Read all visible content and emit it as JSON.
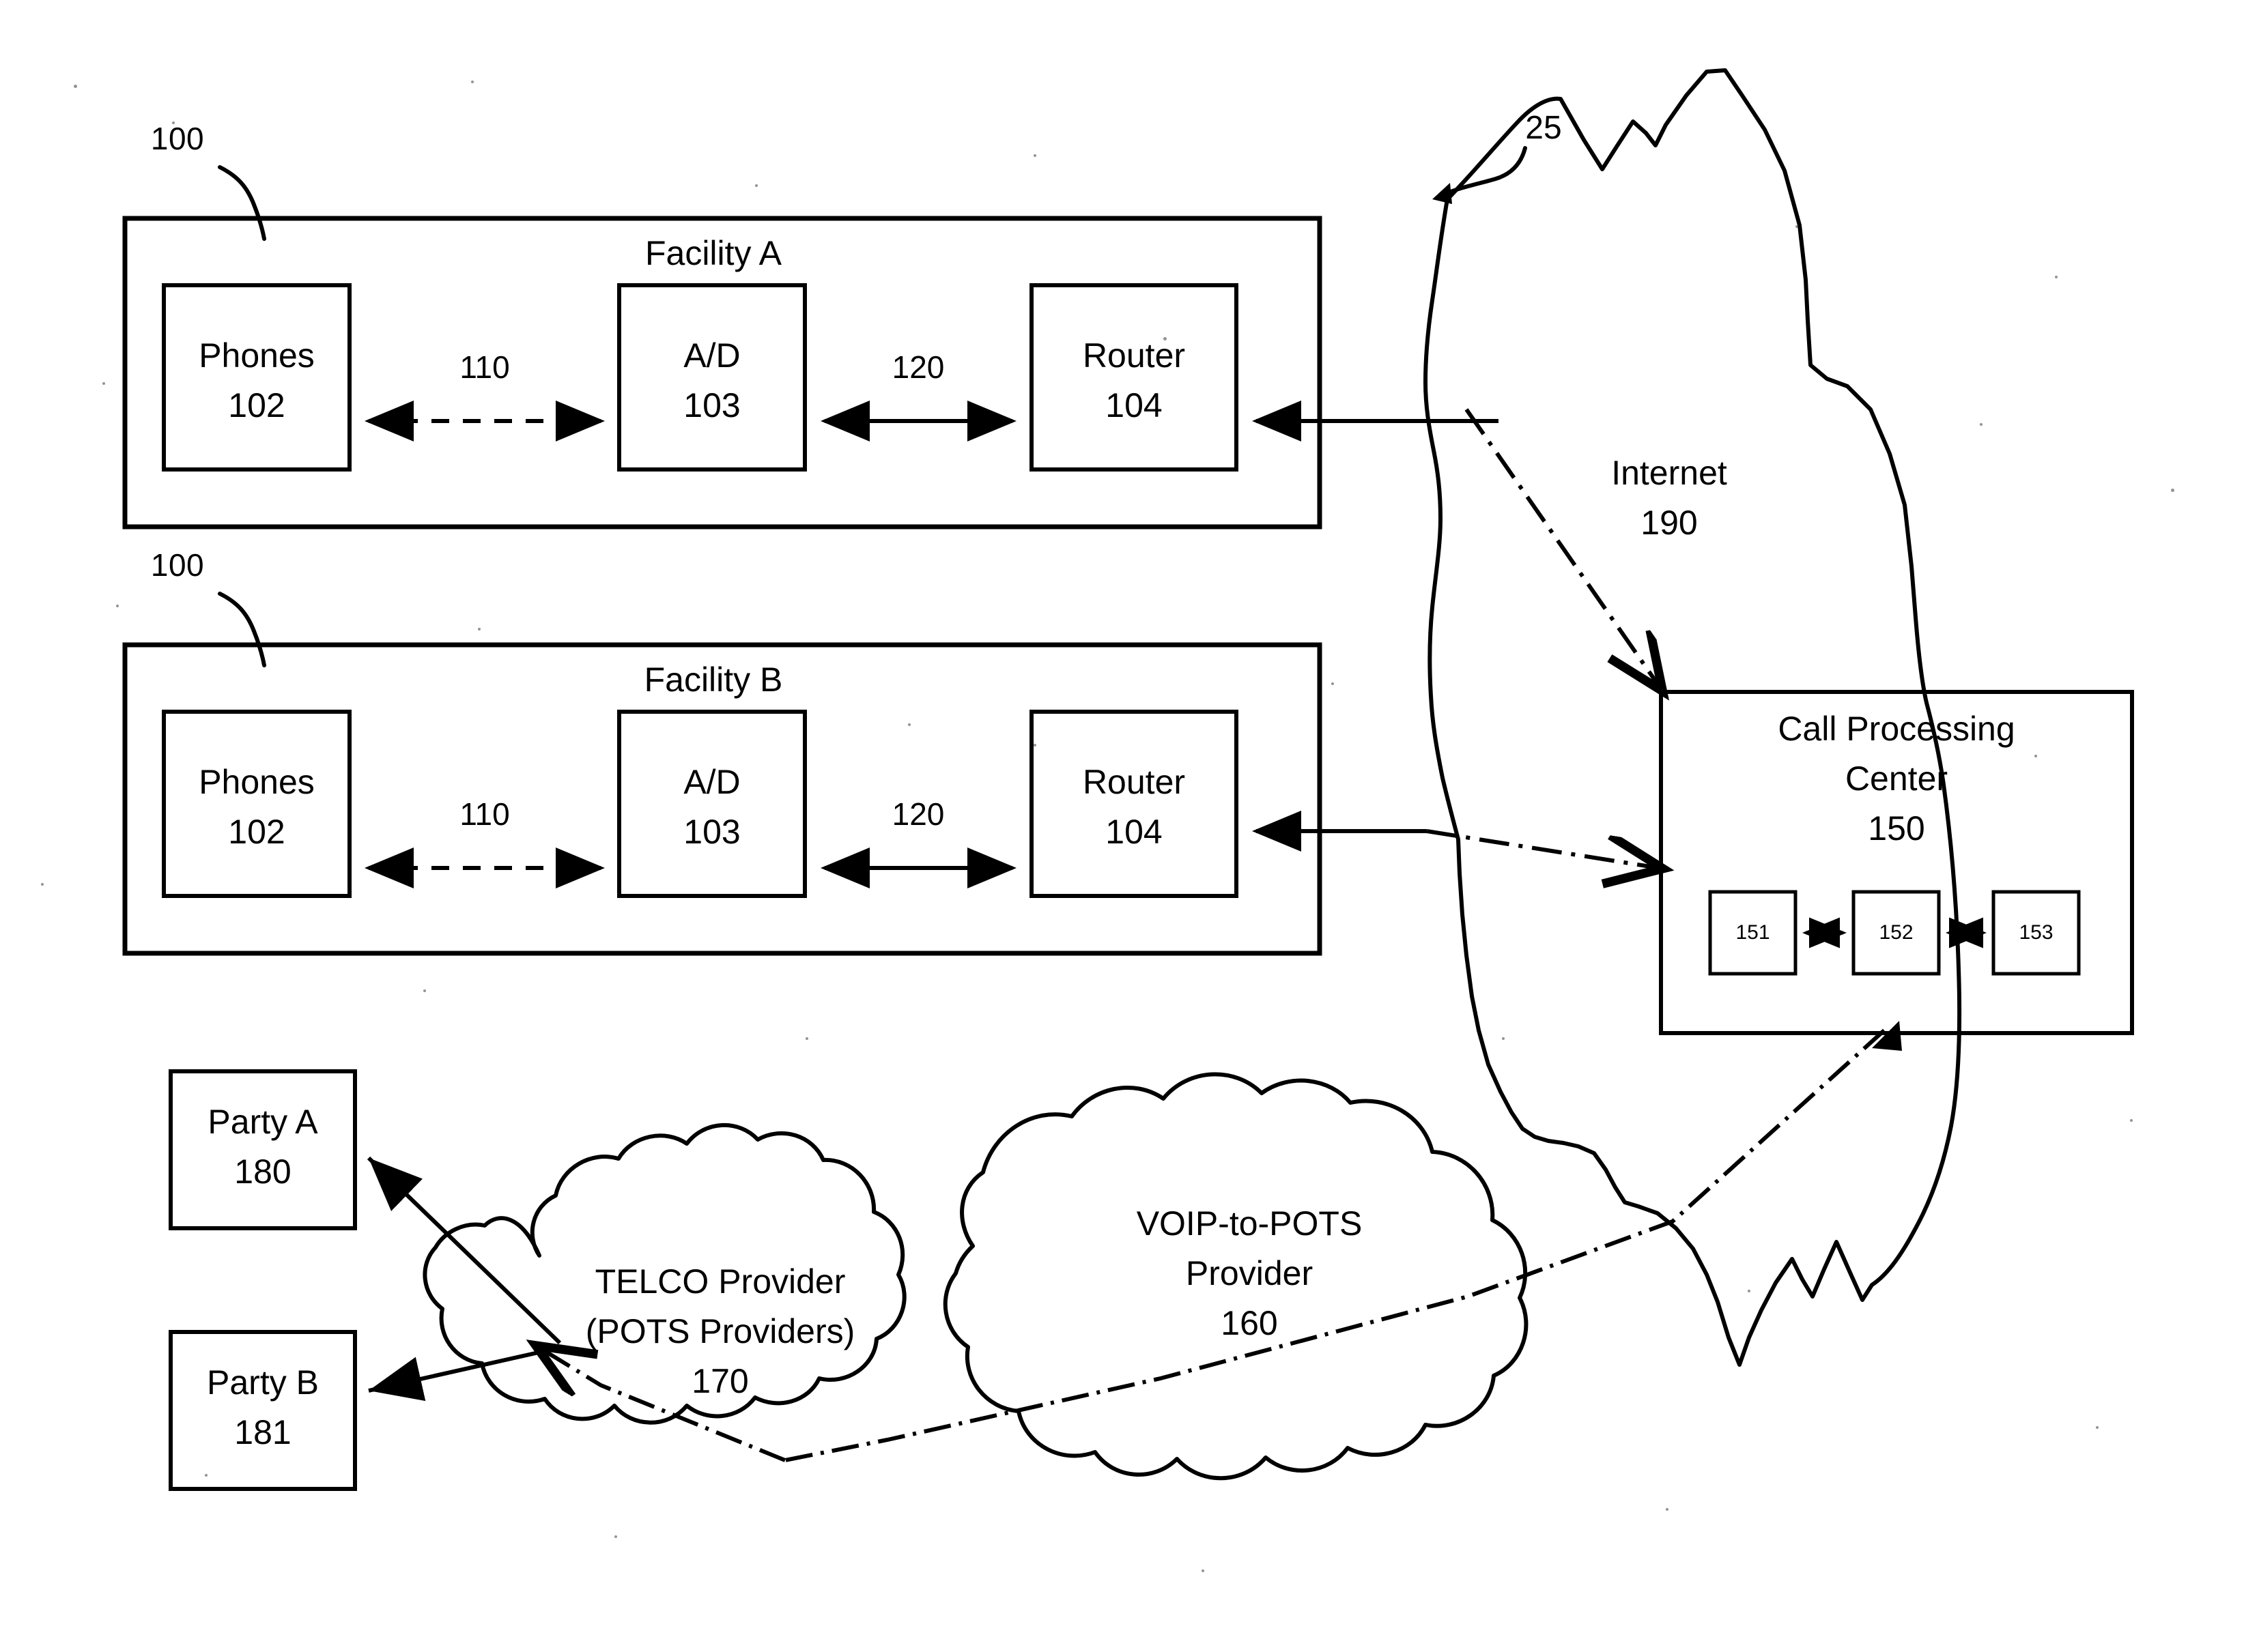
{
  "figure": {
    "figure_ref": "25"
  },
  "facilities": [
    {
      "outer_ref": "100",
      "title": "Facility A",
      "nodes": [
        {
          "name": "Phones",
          "ref": "102"
        },
        {
          "name": "A/D",
          "ref": "103"
        },
        {
          "name": "Router",
          "ref": "104"
        }
      ],
      "links": [
        {
          "ref": "110",
          "style": "dashed"
        },
        {
          "ref": "120",
          "style": "solid"
        }
      ]
    },
    {
      "outer_ref": "100",
      "title": "Facility B",
      "nodes": [
        {
          "name": "Phones",
          "ref": "102"
        },
        {
          "name": "A/D",
          "ref": "103"
        },
        {
          "name": "Router",
          "ref": "104"
        }
      ],
      "links": [
        {
          "ref": "110",
          "style": "dashed"
        },
        {
          "ref": "120",
          "style": "solid"
        }
      ]
    }
  ],
  "internet_cloud": {
    "name": "Internet",
    "ref": "190"
  },
  "call_processing_center": {
    "line1": "Call Processing",
    "line2": "Center",
    "ref": "150",
    "modules": [
      {
        "ref": "151"
      },
      {
        "ref": "152"
      },
      {
        "ref": "153"
      }
    ]
  },
  "voip_cloud": {
    "line1": "VOIP-to-POTS",
    "line2": "Provider",
    "ref": "160"
  },
  "telco_cloud": {
    "line1": "TELCO Provider",
    "line2": "(POTS Providers)",
    "ref": "170"
  },
  "parties": [
    {
      "name": "Party A",
      "ref": "180"
    },
    {
      "name": "Party B",
      "ref": "181"
    }
  ]
}
